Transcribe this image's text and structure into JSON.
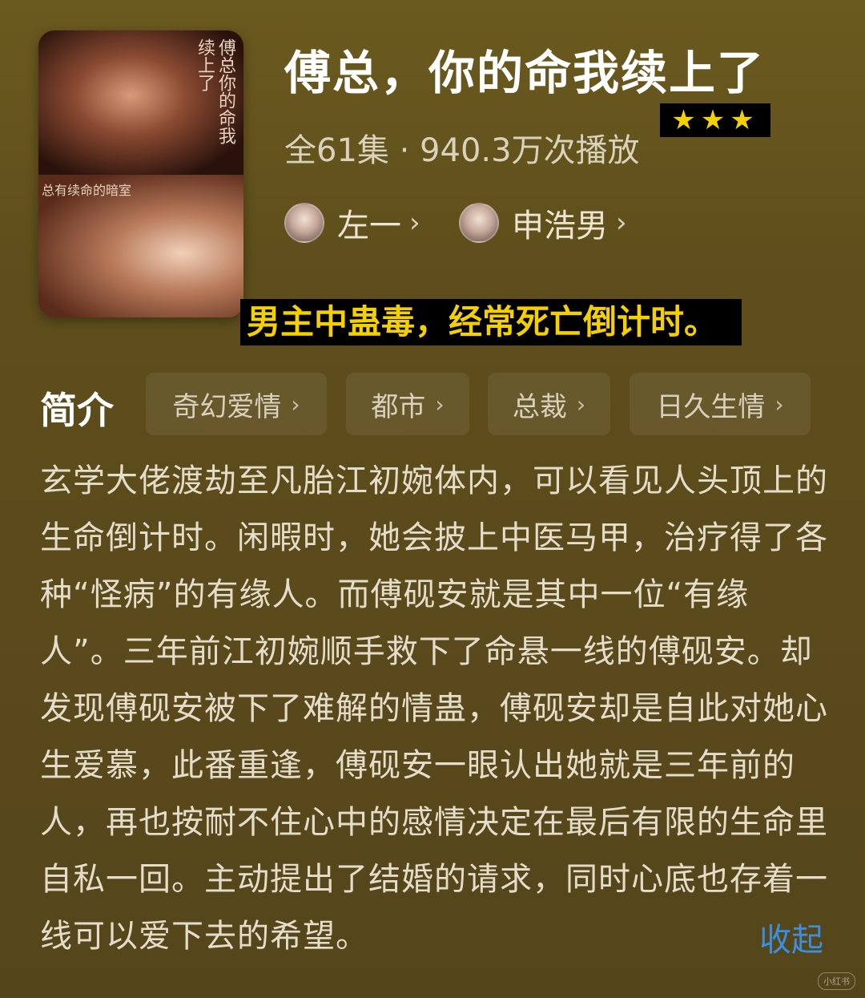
{
  "poster": {
    "calligraphy": "傅总你的命我续上了",
    "band_text": "总有续命的暗室",
    "actor_tag_1": "申浩男",
    "actor_tag_2": "左一"
  },
  "title": "傅总，你的命我续上了",
  "rating_stars": "★★★",
  "meta": "全61集 · 940.3万次播放",
  "cast": [
    {
      "name": "左一",
      "chevron": "›"
    },
    {
      "name": "申浩男",
      "chevron": "›"
    }
  ],
  "caption": "男主中蛊毒，经常死亡倒计时。",
  "intro_label": "简介",
  "tags": [
    {
      "label": "奇幻爱情",
      "chevron": "›"
    },
    {
      "label": "都市",
      "chevron": "›"
    },
    {
      "label": "总裁",
      "chevron": "›"
    },
    {
      "label": "日久生情",
      "chevron": "›"
    }
  ],
  "description": "玄学大佬渡劫至凡胎江初婉体内，可以看见人头顶上的生命倒计时。闲暇时，她会披上中医马甲，治疗得了各种“怪病”的有缘人。而傅砚安就是其中一位“有缘人”。三年前江初婉顺手救下了命悬一线的傅砚安。却发现傅砚安被下了难解的情蛊，傅砚安却是自此对她心生爱慕，此番重逢，傅砚安一眼认出她就是三年前的人，再也按耐不住心中的感情决定在最后有限的生命里自私一回。主动提出了结婚的请求，同时心底也存着一线可以爱下去的希望。",
  "collapse_label": "收起",
  "watermark": "小红书"
}
